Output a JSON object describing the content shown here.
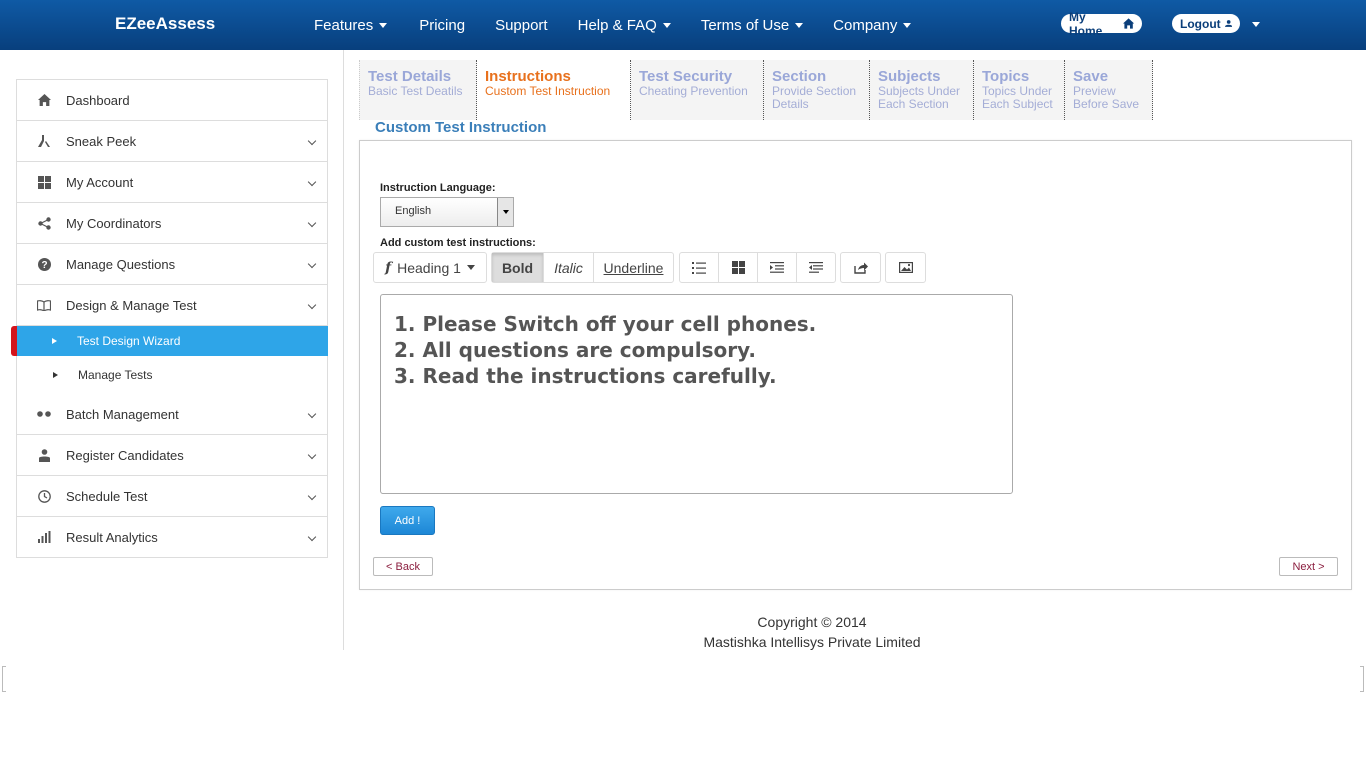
{
  "navbar": {
    "brand": "EZeeAssess",
    "items": [
      {
        "label": "Features",
        "has_dropdown": true
      },
      {
        "label": "Pricing",
        "has_dropdown": false
      },
      {
        "label": "Support",
        "has_dropdown": false
      },
      {
        "label": "Help & FAQ",
        "has_dropdown": true
      },
      {
        "label": "Terms of Use",
        "has_dropdown": true
      },
      {
        "label": "Company",
        "has_dropdown": true
      }
    ],
    "my_home": "My Home",
    "logout": "Logout",
    "home_icon": "home-icon",
    "user_icon": "user-icon"
  },
  "sidebar": {
    "items": [
      {
        "label": "Dashboard",
        "icon": "home-icon"
      },
      {
        "label": "Sneak Peek",
        "icon": "flask-icon"
      },
      {
        "label": "My Account",
        "icon": "grid-icon"
      },
      {
        "label": "My Coordinators",
        "icon": "share-icon"
      },
      {
        "label": "Manage Questions",
        "icon": "question-circle-icon"
      },
      {
        "label": "Design & Manage Test",
        "icon": "book-icon"
      },
      {
        "label": "Batch Management",
        "icon": "dots-icon"
      },
      {
        "label": "Register Candidates",
        "icon": "person-icon"
      },
      {
        "label": "Schedule Test",
        "icon": "clock-icon"
      },
      {
        "label": "Result Analytics",
        "icon": "bar-chart-icon"
      }
    ],
    "subitems": [
      {
        "label": "Test Design Wizard",
        "active": true
      },
      {
        "label": "Manage Tests",
        "active": false
      }
    ]
  },
  "wizard": {
    "tabs": [
      {
        "title": "Test Details",
        "sub1": "Basic Test Deatils",
        "sub2": ""
      },
      {
        "title": "Instructions",
        "sub1": "Custom Test Instruction",
        "sub2": ""
      },
      {
        "title": "Test Security",
        "sub1": "Cheating Prevention",
        "sub2": ""
      },
      {
        "title": "Section",
        "sub1": "Provide Section",
        "sub2": "Details"
      },
      {
        "title": "Subjects",
        "sub1": "Subjects Under",
        "sub2": "Each Section"
      },
      {
        "title": "Topics",
        "sub1": "Topics Under",
        "sub2": "Each Subject"
      },
      {
        "title": "Save",
        "sub1": "Preview",
        "sub2": "Before Save"
      }
    ],
    "active_tab": "Instructions"
  },
  "main": {
    "section_title": "Custom Test Instruction",
    "language_label": "Instruction Language:",
    "language_value": "English",
    "instructions_label": "Add custom test instructions:",
    "toolbar": {
      "heading": "Heading 1",
      "bold": "Bold",
      "italic": "Italic",
      "underline": "Underline"
    },
    "editor_lines": [
      "1. Please Switch off your cell phones.",
      "2. All questions are compulsory.",
      "3. Read the instructions carefully."
    ],
    "add_button": "Add !",
    "back_button": "< Back",
    "next_button": "Next >"
  },
  "footer": {
    "copyright": "Copyright © 2014",
    "company": "Mastishka Intellisys Private Limited"
  },
  "colors": {
    "navbar": "#0b4c92",
    "active_sidebar": "#2ea5e8",
    "active_tab": "#e8711d",
    "inactive_tab": "#9aa7d8",
    "accent_red": "#d3141c"
  }
}
